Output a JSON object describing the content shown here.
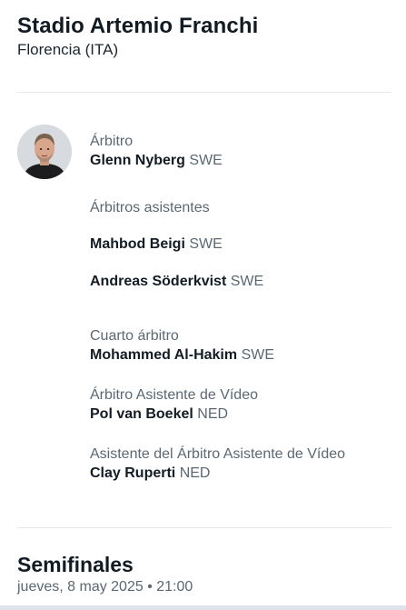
{
  "venue": {
    "name": "Stadio Artemio Franchi",
    "city": "Florencia (ITA)"
  },
  "officials": {
    "referee": {
      "role": "Árbitro",
      "name": "Glenn Nyberg",
      "country": "SWE"
    },
    "assistants": {
      "role": "Árbitros asistentes",
      "people": [
        {
          "name": "Mahbod Beigi",
          "country": "SWE"
        },
        {
          "name": "Andreas Söderkvist",
          "country": "SWE"
        }
      ]
    },
    "fourth": {
      "role": "Cuarto árbitro",
      "name": "Mohammed Al-Hakim",
      "country": "SWE"
    },
    "var": {
      "role": "Árbitro Asistente de Vídeo",
      "name": "Pol van Boekel",
      "country": "NED"
    },
    "avar": {
      "role": "Asistente del Árbitro Asistente de Vídeo",
      "name": "Clay Ruperti",
      "country": "NED"
    }
  },
  "match": {
    "stage": "Semifinales",
    "datetime": "jueves, 8 may 2025 • 21:00"
  }
}
